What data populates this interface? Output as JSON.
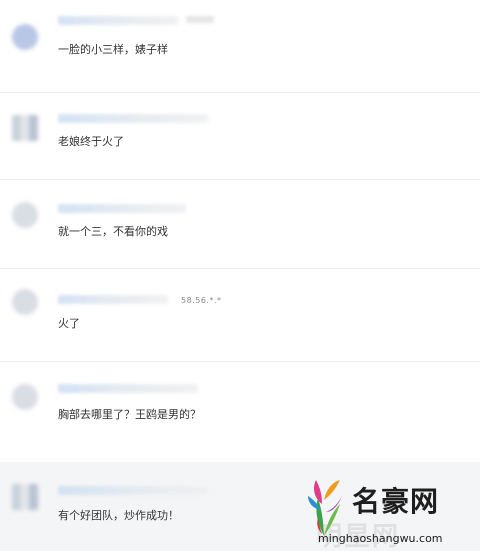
{
  "comments": [
    {
      "text": "一脸的小三样，婊子样"
    },
    {
      "text": "老娘终于火了"
    },
    {
      "text": "就一个三，不看你的戏"
    },
    {
      "text": "火了",
      "ip": "58.56.*.*"
    },
    {
      "text": "胸部去哪里了？王鸥是男的？"
    },
    {
      "text": "有个好团队，炒作成功！"
    }
  ],
  "watermark": {
    "title": "名豪网",
    "url": "minghaoshangwu.com"
  },
  "colors": {
    "text": "#333333",
    "divider": "#ececec",
    "username_blur": "#cfe0f3",
    "bottom_band": "#f4f5f7"
  }
}
